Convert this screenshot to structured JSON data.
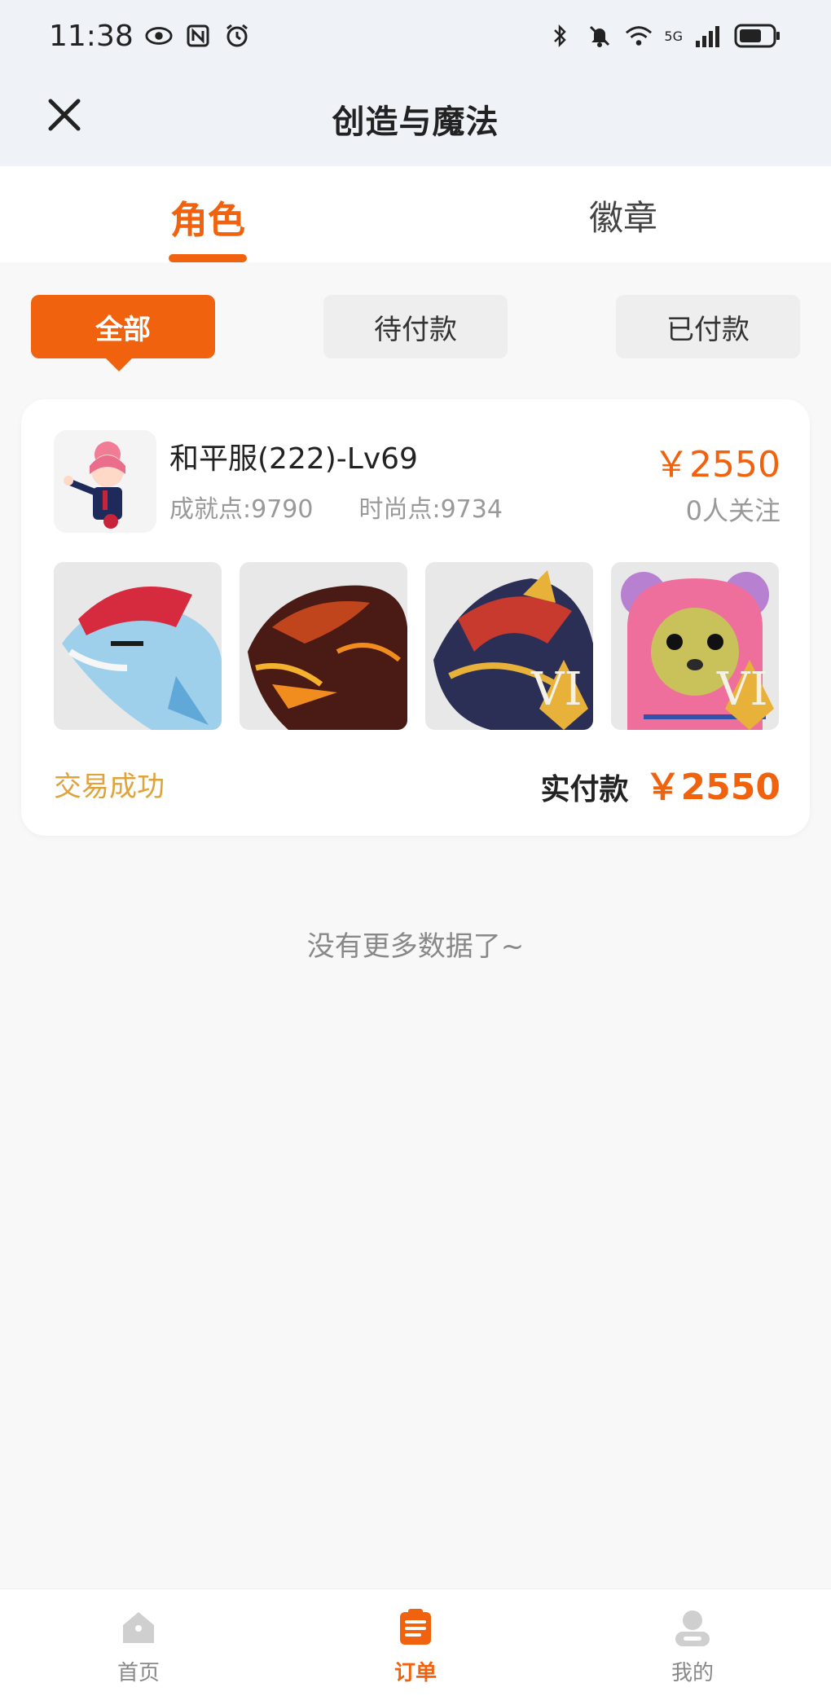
{
  "status_bar": {
    "time": "11:38",
    "network": "5G",
    "icons": [
      "eye-icon",
      "nfc-icon",
      "alarm-icon",
      "bluetooth-icon",
      "mute-icon",
      "wifi-icon",
      "signal-icon",
      "battery-icon"
    ]
  },
  "nav": {
    "title": "创造与魔法",
    "close_icon": "close-icon"
  },
  "tabs": [
    {
      "label": "角色",
      "active": true
    },
    {
      "label": "徽章",
      "active": false
    }
  ],
  "filters": [
    {
      "label": "全部",
      "active": true
    },
    {
      "label": "待付款",
      "active": false
    },
    {
      "label": "已付款",
      "active": false
    }
  ],
  "order": {
    "role_name": "和平服(222)-Lv69",
    "achievement": "成就点:9790",
    "fashion": "时尚点:9734",
    "price": "￥2550",
    "followers": "0人关注",
    "items": [
      {
        "name": "red-fish-mount",
        "badge": ""
      },
      {
        "name": "fire-dragon-mount",
        "badge": ""
      },
      {
        "name": "gold-dragon-mount",
        "badge": "VI"
      },
      {
        "name": "pink-bear-pet",
        "badge": "VI"
      }
    ],
    "status": "交易成功",
    "paid_label": "实付款",
    "paid_amount": "￥2550"
  },
  "footer_text": "没有更多数据了~",
  "bottom_nav": [
    {
      "label": "首页",
      "icon": "home-icon",
      "active": false
    },
    {
      "label": "订单",
      "icon": "order-icon",
      "active": true
    },
    {
      "label": "我的",
      "icon": "user-icon",
      "active": false
    }
  ],
  "colors": {
    "accent": "#f0620d",
    "status_success": "#e0a23a",
    "header_bg": "#eff3f7"
  }
}
